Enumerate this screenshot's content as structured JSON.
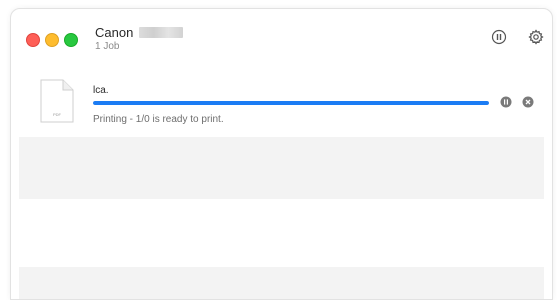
{
  "window": {
    "printer_name": "Canon",
    "job_count": "1 Job"
  },
  "toolbar": {
    "pause_icon": "pause-circle-icon",
    "settings_icon": "gear-icon"
  },
  "job": {
    "title": "lca.",
    "status": "Printing - 1/0 is ready to print.",
    "progress_percent": 100,
    "doc_icon_label": "PDF",
    "accent_color": "#1b7cf4"
  },
  "colors": {
    "close": "#fe5f57",
    "minimize": "#febc2e",
    "zoom": "#28c840",
    "row_alt": "#f3f3f3"
  }
}
